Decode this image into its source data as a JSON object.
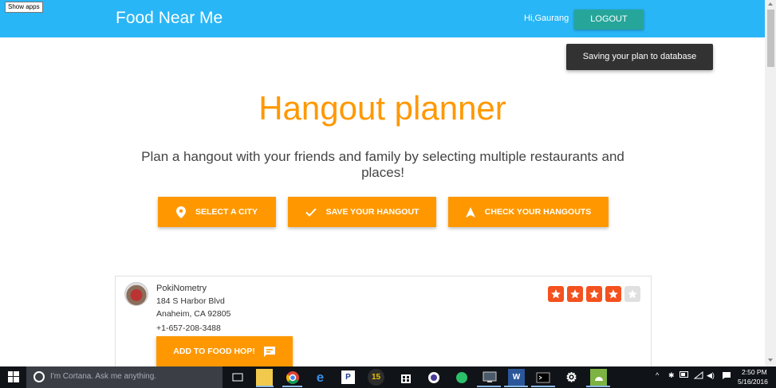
{
  "overlay": {
    "show_apps": "Show apps"
  },
  "navbar": {
    "brand": "Food Near Me",
    "greeting": "Hi,Gaurang",
    "logout_label": "LOGOUT",
    "bg_color": "#29b6f6",
    "logout_color": "#26a69a"
  },
  "toast": {
    "message": "Saving your plan to database"
  },
  "hero": {
    "title": "Hangout planner",
    "subtitle": "Plan a hangout with your friends and family by selecting multiple restaurants and places!",
    "accent_color": "#ff9800"
  },
  "actions": [
    {
      "label": "SELECT A CITY",
      "icon": "location-pin-icon"
    },
    {
      "label": "SAVE YOUR HANGOUT",
      "icon": "checkmark-icon"
    },
    {
      "label": "CHECK YOUR HANGOUTS",
      "icon": "navigation-arrow-icon"
    }
  ],
  "restaurant": {
    "name": "PokiNometry",
    "address_line1": "184 S Harbor Blvd",
    "address_line2": "Anaheim, CA 92805",
    "phone": "+1-657-208-3488",
    "rating": 4,
    "rating_max": 5,
    "add_label": "ADD TO FOOD HOP!",
    "star_color": "#f4511e"
  },
  "taskbar": {
    "search_placeholder": "I'm Cortana. Ask me anything.",
    "time": "2:50 PM",
    "date": "5/16/2016",
    "pinned_apps": [
      "task-view-icon",
      "file-explorer-icon",
      "chrome-icon",
      "edge-icon",
      "pandora-icon",
      "fifteen-app-icon",
      "store-icon",
      "media-app-icon",
      "green-app-icon",
      "monitor-app-icon",
      "word-icon",
      "terminal-icon",
      "settings-gear-icon",
      "android-app-icon"
    ]
  }
}
